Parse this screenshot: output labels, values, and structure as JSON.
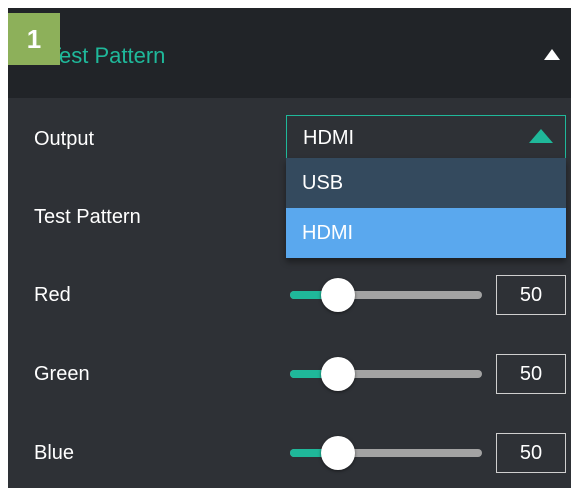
{
  "badge": "1",
  "header": {
    "title": "Test Pattern"
  },
  "output": {
    "label": "Output",
    "selected": "HDMI",
    "options": [
      "USB",
      "HDMI"
    ]
  },
  "test_pattern": {
    "label": "Test Pattern"
  },
  "sliders": [
    {
      "label": "Red",
      "value": "50",
      "fraction": 0.25
    },
    {
      "label": "Green",
      "value": "50",
      "fraction": 0.25
    },
    {
      "label": "Blue",
      "value": "50",
      "fraction": 0.25
    }
  ],
  "colors": {
    "accent": "#1fb89a",
    "panel": "#2e3136",
    "header": "#212428",
    "highlight": "#5aa8ee",
    "badge": "#8db05a"
  }
}
